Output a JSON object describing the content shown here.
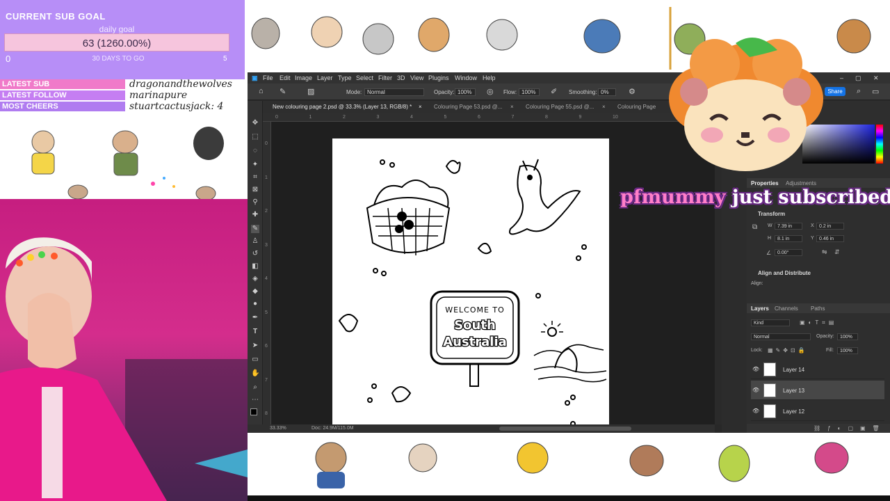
{
  "sub_goal": {
    "title": "CURRENT SUB GOAL",
    "subtitle": "daily goal",
    "value_text": "63 (1260.00%)",
    "progress_fraction": 1.0,
    "min": "0",
    "days_left": "30 DAYS TO GO",
    "max": "5"
  },
  "latest": [
    {
      "label": "LATEST SUB",
      "name": "dragonandthewolves",
      "color": "#f07ac9"
    },
    {
      "label": "LATEST FOLLOW",
      "name": "marinapure",
      "color": "#c57ef2"
    },
    {
      "label": "MOST CHEERS",
      "name": "stuartcactusjack: 4",
      "color": "#b07cf0"
    }
  ],
  "menu": [
    "File",
    "Edit",
    "Image",
    "Layer",
    "Type",
    "Select",
    "Filter",
    "3D",
    "View",
    "Plugins",
    "Window",
    "Help"
  ],
  "options": {
    "mode_label": "Mode:",
    "mode_value": "Normal",
    "opacity_label": "Opacity:",
    "opacity_value": "100%",
    "flow_label": "Flow:",
    "flow_value": "100%",
    "smoothing_label": "Smoothing:",
    "smoothing_value": "0%"
  },
  "tabs": [
    {
      "label": "New colouring page 2.psd @ 33.3% (Layer 13, RGB/8) *",
      "close": "×"
    },
    {
      "label": "Colouring Page 53.psd @...",
      "close": "×"
    },
    {
      "label": "Colouring Page 55.psd @...",
      "close": "×"
    },
    {
      "label": "Colouring Page",
      "close": ""
    }
  ],
  "ruler_h": [
    "0",
    "1",
    "2",
    "3",
    "4",
    "5",
    "6",
    "7",
    "8",
    "9",
    "10"
  ],
  "ruler_v": [
    "0",
    "1",
    "2",
    "3",
    "4",
    "5",
    "6",
    "7",
    "8"
  ],
  "status": {
    "zoom": "33.33%",
    "doc": "Doc: 24.9M/115.0M"
  },
  "canvas": {
    "sign_line1": "WELCOME TO",
    "sign_line2": "South",
    "sign_line3": "Australia"
  },
  "share_label": "Share",
  "properties": {
    "tabs": [
      "Properties",
      "Adjustments"
    ],
    "transform_title": "Transform",
    "w_label": "W",
    "w_value": "7.39 in",
    "h_label": "H",
    "h_value": "8.1 in",
    "x_label": "X",
    "x_value": "0.2 in",
    "y_label": "Y",
    "y_value": "0.46 in",
    "angle_value": "0.00°",
    "align_title": "Align and Distribute",
    "align_label": "Align:"
  },
  "layers_panel": {
    "tabs": [
      "Layers",
      "Channels",
      "Paths"
    ],
    "kind_label": "Kind",
    "blend_value": "Normal",
    "opacity_label": "Opacity:",
    "opacity_value": "100%",
    "lock_label": "Lock:",
    "fill_label": "Fill:",
    "fill_value": "100%",
    "layers": [
      {
        "name": "Layer 14",
        "selected": false
      },
      {
        "name": "Layer 13",
        "selected": true
      },
      {
        "name": "Layer 12",
        "selected": false
      }
    ]
  },
  "alert": {
    "user": "pfmummy",
    "message": " just subscribed!"
  },
  "colors": {
    "goal_bg": "#b78ef7",
    "goal_bar": "#f2b7d4",
    "cam_pink": "#c61e80",
    "ps_bg": "#282828",
    "alert_outline": "#6a2a86",
    "alert_user": "#ff7ec9",
    "share_button": "#1473e6"
  }
}
